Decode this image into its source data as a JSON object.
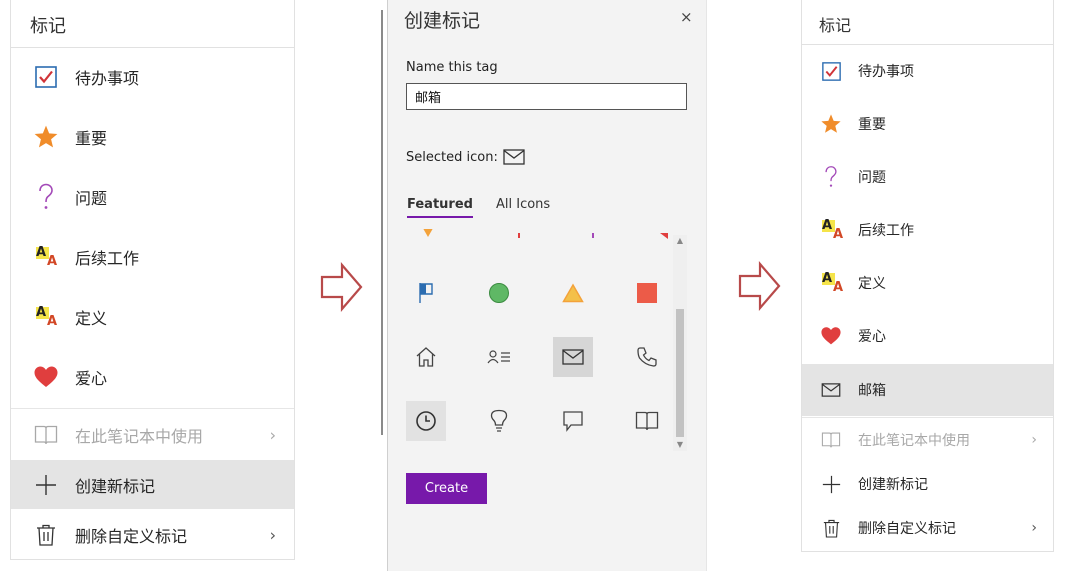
{
  "left_panel": {
    "title": "标记",
    "items": [
      {
        "label": "待办事项",
        "icon": "checkbox-checked-icon"
      },
      {
        "label": "重要",
        "icon": "star-icon"
      },
      {
        "label": "问题",
        "icon": "question-mark-icon"
      },
      {
        "label": "后续工作",
        "icon": "highlight-aa-icon"
      },
      {
        "label": "定义",
        "icon": "highlight-aa-icon"
      },
      {
        "label": "爱心",
        "icon": "heart-icon"
      }
    ],
    "footer": [
      {
        "label": "在此笔记本中使用",
        "icon": "book-icon",
        "chevron": "›",
        "disabled": true
      },
      {
        "label": "创建新标记",
        "icon": "plus-icon",
        "highlighted": true
      },
      {
        "label": "删除自定义标记",
        "icon": "trash-icon",
        "chevron": "›"
      }
    ]
  },
  "dialog": {
    "title": "创建标记",
    "close": "×",
    "name_label": "Name this tag",
    "name_value": "邮箱",
    "selected_icon_label": "Selected icon:",
    "selected_icon": "envelope-icon",
    "tabs": [
      {
        "label": "Featured",
        "active": true
      },
      {
        "label": "All Icons",
        "active": false
      }
    ],
    "icon_grid": [
      [
        "flag-icon",
        "circle-icon",
        "triangle-icon",
        "square-icon"
      ],
      [
        "home-icon",
        "contact-list-icon",
        "envelope-icon",
        "phone-icon"
      ],
      [
        "clock-icon",
        "lightbulb-icon",
        "speech-bubble-icon",
        "book-icon"
      ]
    ],
    "selected_cell": "envelope-icon",
    "create_label": "Create"
  },
  "right_panel": {
    "title": "标记",
    "items": [
      {
        "label": "待办事项",
        "icon": "checkbox-checked-icon"
      },
      {
        "label": "重要",
        "icon": "star-icon"
      },
      {
        "label": "问题",
        "icon": "question-mark-icon"
      },
      {
        "label": "后续工作",
        "icon": "highlight-aa-icon"
      },
      {
        "label": "定义",
        "icon": "highlight-aa-icon"
      },
      {
        "label": "爱心",
        "icon": "heart-icon"
      },
      {
        "label": "邮箱",
        "icon": "envelope-icon",
        "highlighted": true
      }
    ],
    "footer": [
      {
        "label": "在此笔记本中使用",
        "icon": "book-icon",
        "chevron": "›",
        "disabled": true
      },
      {
        "label": "创建新标记",
        "icon": "plus-icon"
      },
      {
        "label": "删除自定义标记",
        "icon": "trash-icon",
        "chevron": "›"
      }
    ]
  },
  "aa_letters": {
    "top": "A",
    "bottom": "A"
  },
  "colors": {
    "check": "#d13438",
    "star": "#f08c2a",
    "question": "#a349b8",
    "heart": "#e03e3e",
    "accent": "#7719aa",
    "arrow": "#b84a4a",
    "green": "#5fb865",
    "orange": "#f3a23a",
    "red": "#ec5b48",
    "blue": "#2b6cb0"
  }
}
